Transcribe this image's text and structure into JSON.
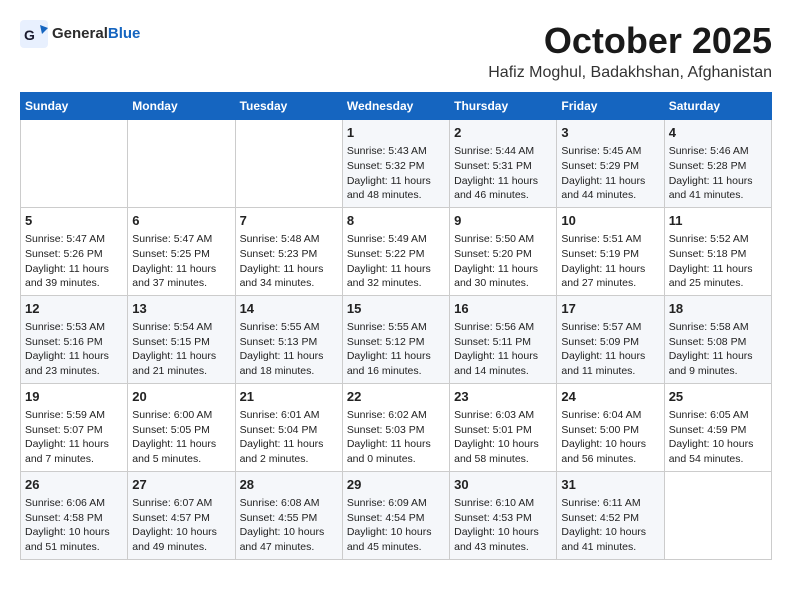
{
  "header": {
    "logo_general": "General",
    "logo_blue": "Blue",
    "month": "October 2025",
    "location": "Hafiz Moghul, Badakhshan, Afghanistan"
  },
  "days_of_week": [
    "Sunday",
    "Monday",
    "Tuesday",
    "Wednesday",
    "Thursday",
    "Friday",
    "Saturday"
  ],
  "weeks": [
    [
      {
        "day": "",
        "data": ""
      },
      {
        "day": "",
        "data": ""
      },
      {
        "day": "",
        "data": ""
      },
      {
        "day": "1",
        "data": "Sunrise: 5:43 AM\nSunset: 5:32 PM\nDaylight: 11 hours and 48 minutes."
      },
      {
        "day": "2",
        "data": "Sunrise: 5:44 AM\nSunset: 5:31 PM\nDaylight: 11 hours and 46 minutes."
      },
      {
        "day": "3",
        "data": "Sunrise: 5:45 AM\nSunset: 5:29 PM\nDaylight: 11 hours and 44 minutes."
      },
      {
        "day": "4",
        "data": "Sunrise: 5:46 AM\nSunset: 5:28 PM\nDaylight: 11 hours and 41 minutes."
      }
    ],
    [
      {
        "day": "5",
        "data": "Sunrise: 5:47 AM\nSunset: 5:26 PM\nDaylight: 11 hours and 39 minutes."
      },
      {
        "day": "6",
        "data": "Sunrise: 5:47 AM\nSunset: 5:25 PM\nDaylight: 11 hours and 37 minutes."
      },
      {
        "day": "7",
        "data": "Sunrise: 5:48 AM\nSunset: 5:23 PM\nDaylight: 11 hours and 34 minutes."
      },
      {
        "day": "8",
        "data": "Sunrise: 5:49 AM\nSunset: 5:22 PM\nDaylight: 11 hours and 32 minutes."
      },
      {
        "day": "9",
        "data": "Sunrise: 5:50 AM\nSunset: 5:20 PM\nDaylight: 11 hours and 30 minutes."
      },
      {
        "day": "10",
        "data": "Sunrise: 5:51 AM\nSunset: 5:19 PM\nDaylight: 11 hours and 27 minutes."
      },
      {
        "day": "11",
        "data": "Sunrise: 5:52 AM\nSunset: 5:18 PM\nDaylight: 11 hours and 25 minutes."
      }
    ],
    [
      {
        "day": "12",
        "data": "Sunrise: 5:53 AM\nSunset: 5:16 PM\nDaylight: 11 hours and 23 minutes."
      },
      {
        "day": "13",
        "data": "Sunrise: 5:54 AM\nSunset: 5:15 PM\nDaylight: 11 hours and 21 minutes."
      },
      {
        "day": "14",
        "data": "Sunrise: 5:55 AM\nSunset: 5:13 PM\nDaylight: 11 hours and 18 minutes."
      },
      {
        "day": "15",
        "data": "Sunrise: 5:55 AM\nSunset: 5:12 PM\nDaylight: 11 hours and 16 minutes."
      },
      {
        "day": "16",
        "data": "Sunrise: 5:56 AM\nSunset: 5:11 PM\nDaylight: 11 hours and 14 minutes."
      },
      {
        "day": "17",
        "data": "Sunrise: 5:57 AM\nSunset: 5:09 PM\nDaylight: 11 hours and 11 minutes."
      },
      {
        "day": "18",
        "data": "Sunrise: 5:58 AM\nSunset: 5:08 PM\nDaylight: 11 hours and 9 minutes."
      }
    ],
    [
      {
        "day": "19",
        "data": "Sunrise: 5:59 AM\nSunset: 5:07 PM\nDaylight: 11 hours and 7 minutes."
      },
      {
        "day": "20",
        "data": "Sunrise: 6:00 AM\nSunset: 5:05 PM\nDaylight: 11 hours and 5 minutes."
      },
      {
        "day": "21",
        "data": "Sunrise: 6:01 AM\nSunset: 5:04 PM\nDaylight: 11 hours and 2 minutes."
      },
      {
        "day": "22",
        "data": "Sunrise: 6:02 AM\nSunset: 5:03 PM\nDaylight: 11 hours and 0 minutes."
      },
      {
        "day": "23",
        "data": "Sunrise: 6:03 AM\nSunset: 5:01 PM\nDaylight: 10 hours and 58 minutes."
      },
      {
        "day": "24",
        "data": "Sunrise: 6:04 AM\nSunset: 5:00 PM\nDaylight: 10 hours and 56 minutes."
      },
      {
        "day": "25",
        "data": "Sunrise: 6:05 AM\nSunset: 4:59 PM\nDaylight: 10 hours and 54 minutes."
      }
    ],
    [
      {
        "day": "26",
        "data": "Sunrise: 6:06 AM\nSunset: 4:58 PM\nDaylight: 10 hours and 51 minutes."
      },
      {
        "day": "27",
        "data": "Sunrise: 6:07 AM\nSunset: 4:57 PM\nDaylight: 10 hours and 49 minutes."
      },
      {
        "day": "28",
        "data": "Sunrise: 6:08 AM\nSunset: 4:55 PM\nDaylight: 10 hours and 47 minutes."
      },
      {
        "day": "29",
        "data": "Sunrise: 6:09 AM\nSunset: 4:54 PM\nDaylight: 10 hours and 45 minutes."
      },
      {
        "day": "30",
        "data": "Sunrise: 6:10 AM\nSunset: 4:53 PM\nDaylight: 10 hours and 43 minutes."
      },
      {
        "day": "31",
        "data": "Sunrise: 6:11 AM\nSunset: 4:52 PM\nDaylight: 10 hours and 41 minutes."
      },
      {
        "day": "",
        "data": ""
      }
    ]
  ]
}
